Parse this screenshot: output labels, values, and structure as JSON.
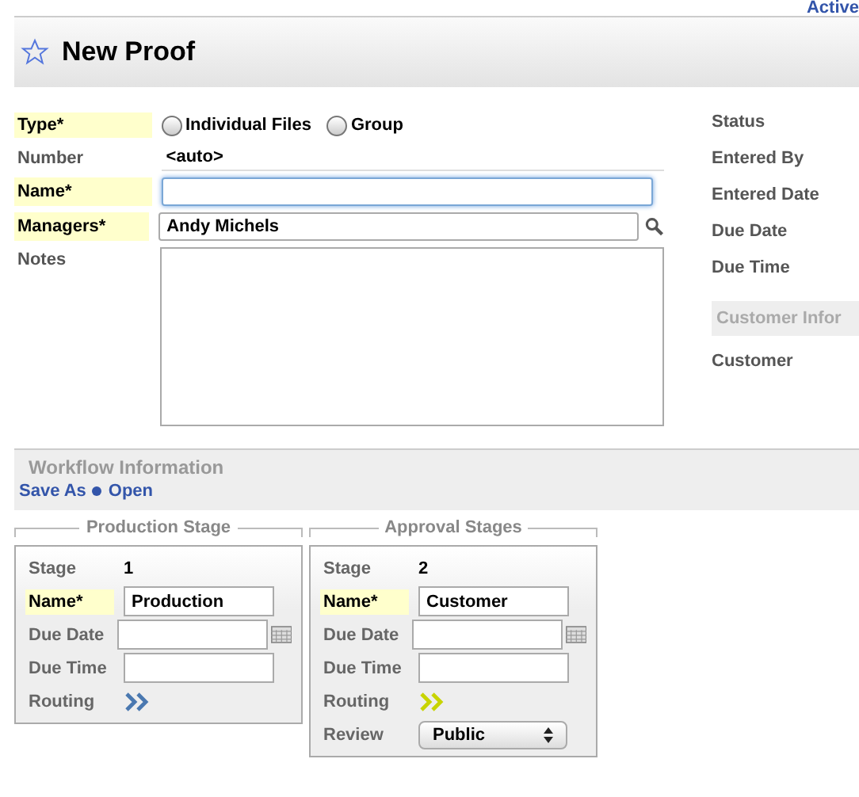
{
  "top_link": "Active",
  "header": {
    "title": "New Proof",
    "favorite": false
  },
  "form": {
    "type": {
      "label": "Type*",
      "required": true,
      "options": [
        {
          "label": "Individual Files",
          "selected": false
        },
        {
          "label": "Group",
          "selected": false
        }
      ]
    },
    "number": {
      "label": "Number",
      "value": "<auto>"
    },
    "name": {
      "label": "Name*",
      "required": true,
      "focused": true
    },
    "managers": {
      "label": "Managers*",
      "required": true,
      "value": "Andy Michels"
    },
    "notes": {
      "label": "Notes"
    }
  },
  "side": {
    "fields": [
      "Status",
      "Entered By",
      "Entered Date",
      "Due Date",
      "Due Time"
    ],
    "section": "Customer Infor",
    "section_fields": [
      "Customer"
    ]
  },
  "workflow": {
    "title": "Workflow Information",
    "links": [
      "Save As",
      "Open"
    ]
  },
  "stages": [
    {
      "group": "Production Stage",
      "stage_label": "Stage",
      "stage": "1",
      "name_label": "Name*",
      "name": "Production",
      "due_date_label": "Due Date",
      "due_time_label": "Due Time",
      "routing_label": "Routing",
      "color": "#4a78b0"
    },
    {
      "group": "Approval Stages",
      "stage_label": "Stage",
      "stage": "2",
      "name_label": "Name*",
      "name": "Customer",
      "due_date_label": "Due Date",
      "due_time_label": "Due Time",
      "routing_label": "Routing",
      "color": "#c8d400",
      "review_label": "Review",
      "review": "Public"
    }
  ]
}
